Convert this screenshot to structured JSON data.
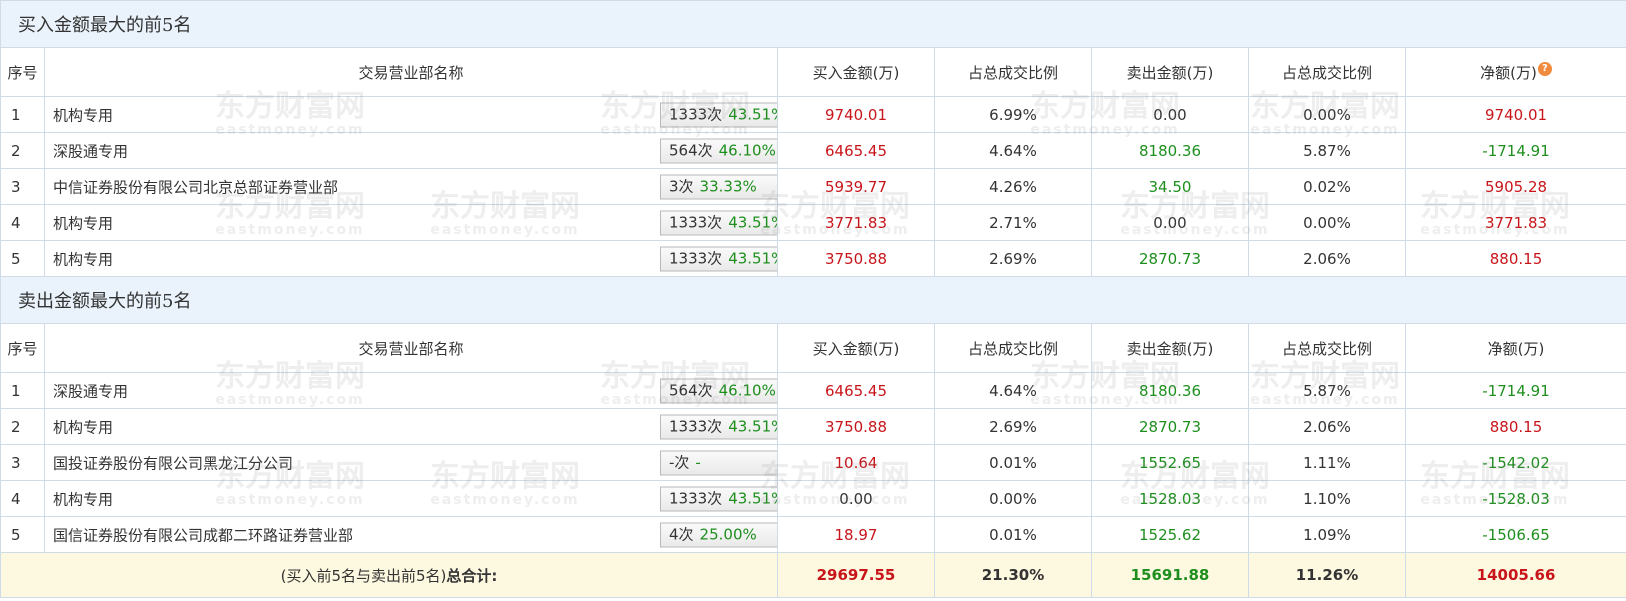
{
  "headers": {
    "seq": "序号",
    "branch": "交易营业部名称",
    "buy_amount": "买入金额(万)",
    "buy_ratio": "占总成交比例",
    "sell_amount": "卖出金额(万)",
    "sell_ratio": "占总成交比例",
    "net": "净额(万)"
  },
  "help_glyph": "?",
  "watermark": {
    "main": "东方财富网",
    "sub": "eastmoney.com"
  },
  "buy_section": {
    "title": "买入金额最大的前5名",
    "rows": [
      {
        "seq": "1",
        "name": "机构专用",
        "count": "1333次",
        "pct": "43.51%",
        "buy": "9740.01",
        "buy_ratio": "6.99%",
        "sell": "0.00",
        "sell_ratio": "0.00%",
        "net": "9740.01",
        "marker": "help"
      },
      {
        "seq": "2",
        "name": "深股通专用",
        "count": "564次",
        "pct": "46.10%",
        "buy": "6465.45",
        "buy_ratio": "4.64%",
        "sell": "8180.36",
        "sell_ratio": "5.87%",
        "net": "-1714.91",
        "marker": "arrow"
      },
      {
        "seq": "3",
        "name": "中信证券股份有限公司北京总部证券营业部",
        "count": "3次",
        "pct": "33.33%",
        "buy": "5939.77",
        "buy_ratio": "4.26%",
        "sell": "34.50",
        "sell_ratio": "0.02%",
        "net": "5905.28",
        "marker": "arrow"
      },
      {
        "seq": "4",
        "name": "机构专用",
        "count": "1333次",
        "pct": "43.51%",
        "buy": "3771.83",
        "buy_ratio": "2.71%",
        "sell": "0.00",
        "sell_ratio": "0.00%",
        "net": "3771.83",
        "marker": "arrow"
      },
      {
        "seq": "5",
        "name": "机构专用",
        "count": "1333次",
        "pct": "43.51%",
        "buy": "3750.88",
        "buy_ratio": "2.69%",
        "sell": "2870.73",
        "sell_ratio": "2.06%",
        "net": "880.15",
        "marker": "arrow"
      }
    ]
  },
  "sell_section": {
    "title": "卖出金额最大的前5名",
    "rows": [
      {
        "seq": "1",
        "name": "深股通专用",
        "count": "564次",
        "pct": "46.10%",
        "buy": "6465.45",
        "buy_ratio": "4.64%",
        "sell": "8180.36",
        "sell_ratio": "5.87%",
        "net": "-1714.91",
        "marker": "help"
      },
      {
        "seq": "2",
        "name": "机构专用",
        "count": "1333次",
        "pct": "43.51%",
        "buy": "3750.88",
        "buy_ratio": "2.69%",
        "sell": "2870.73",
        "sell_ratio": "2.06%",
        "net": "880.15",
        "marker": "arrow"
      },
      {
        "seq": "3",
        "name": "国投证券股份有限公司黑龙江分公司",
        "count": "-次",
        "pct": "-",
        "buy": "10.64",
        "buy_ratio": "0.01%",
        "sell": "1552.65",
        "sell_ratio": "1.11%",
        "net": "-1542.02",
        "marker": "arrow"
      },
      {
        "seq": "4",
        "name": "机构专用",
        "count": "1333次",
        "pct": "43.51%",
        "buy": "0.00",
        "buy_ratio": "0.00%",
        "sell": "1528.03",
        "sell_ratio": "1.10%",
        "net": "-1528.03",
        "marker": "arrow"
      },
      {
        "seq": "5",
        "name": "国信证券股份有限公司成都二环路证券营业部",
        "count": "4次",
        "pct": "25.00%",
        "buy": "18.97",
        "buy_ratio": "0.01%",
        "sell": "1525.62",
        "sell_ratio": "1.09%",
        "net": "-1506.65",
        "marker": "arrow"
      }
    ]
  },
  "total": {
    "label_prefix": "(买入前5名与卖出前5名)",
    "label_bold": "总合计:",
    "buy": "29697.55",
    "buy_ratio": "21.30%",
    "sell": "15691.88",
    "sell_ratio": "11.26%",
    "net": "14005.66"
  },
  "colors": {
    "buy": "#c8151a",
    "sell": "#1e8f1e",
    "header_bg": "#eaf3fb",
    "total_bg": "#fdf8e0"
  }
}
